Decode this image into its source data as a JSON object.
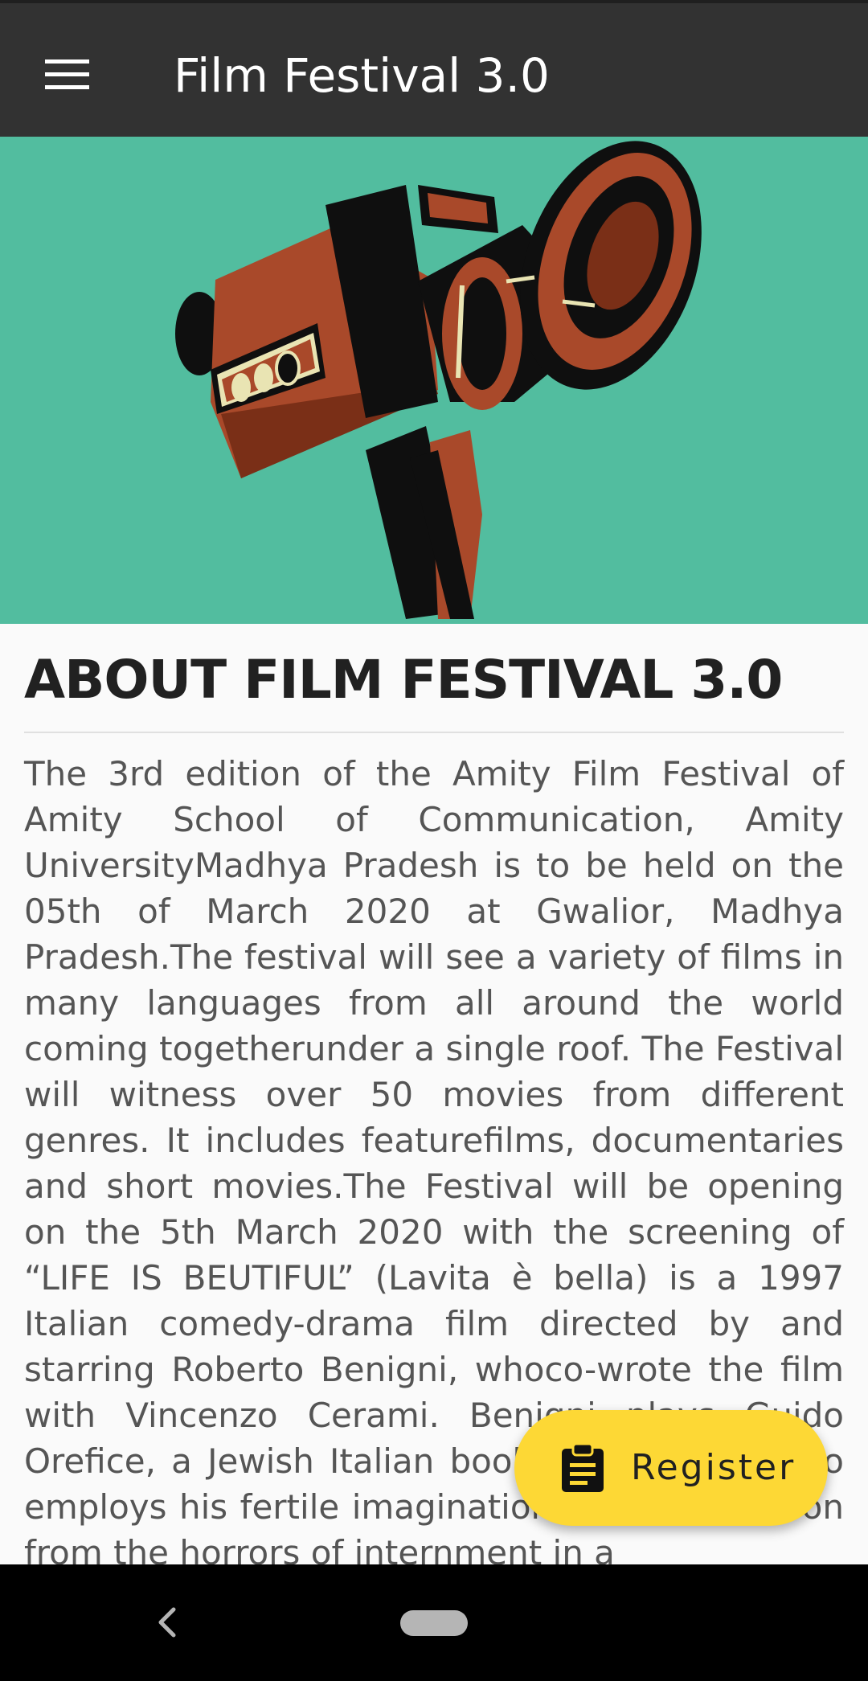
{
  "app_bar": {
    "title": "Film Festival 3.0",
    "menu_icon": "hamburger-menu-icon",
    "background": "#323232"
  },
  "banner": {
    "background": "#52bd9f",
    "image": "vintage-movie-camera-illustration",
    "carousel": {
      "total": 5,
      "active_index": 0
    }
  },
  "about": {
    "heading": "ABOUT FILM FESTIVAL 3.0",
    "body": "The 3rd edition of the Amity Film Festival of Amity School of Communication, Amity UniversityMadhya Pradesh is to be held on the 05th of March 2020 at Gwalior, Madhya Pradesh.The festival will see a variety of films in many languages from all around the world coming togetherunder a single roof. The Festival will witness over 50 movies from different genres. It includes featurefilms, documentaries and short movies.The Festival will be opening on the 5th March 2020 with the screening of “LIFE IS BEUTIFUL” (Lavita è bella) is a 1997 Italian comedy-drama film directed by and starring Roberto Benigni, whoco-wrote the film with Vincenzo Cerami. Benigni plays Guido Orefice, a Jewish Italian book shop owner, who employs his fertile imagination to shield his son from the horrors of internment in a"
  },
  "fab": {
    "label": "Register",
    "icon": "clipboard-icon",
    "color": "#fdd835"
  },
  "system_nav": {
    "back_icon": "back-chevron-icon",
    "home_icon": "home-pill-icon"
  }
}
